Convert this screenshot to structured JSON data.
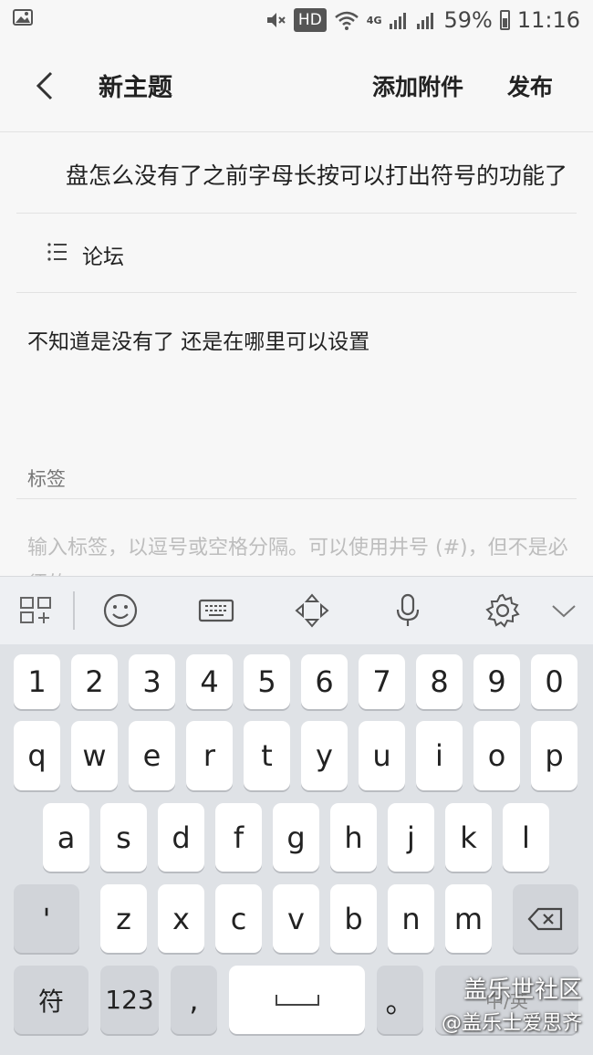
{
  "status_bar": {
    "hd": "HD",
    "network": "4G",
    "battery": "59%",
    "time": "11:16"
  },
  "header": {
    "title": "新主题",
    "attach_label": "添加附件",
    "publish_label": "发布"
  },
  "post": {
    "title": "盘怎么没有了之前字母长按可以打出符号的功能了",
    "category": "论坛",
    "body": "不知道是没有了 还是在哪里可以设置",
    "tag_label": "标签",
    "tag_placeholder": "输入标签，以逗号或空格分隔。可以使用井号 (#)，但不是必须的。"
  },
  "keyboard": {
    "number_row": [
      "1",
      "2",
      "3",
      "4",
      "5",
      "6",
      "7",
      "8",
      "9",
      "0"
    ],
    "row1": [
      "q",
      "w",
      "e",
      "r",
      "t",
      "y",
      "u",
      "i",
      "o",
      "p"
    ],
    "row2": [
      "a",
      "s",
      "d",
      "f",
      "g",
      "h",
      "j",
      "k",
      "l"
    ],
    "row3": [
      "'",
      "z",
      "x",
      "c",
      "v",
      "b",
      "n",
      "m"
    ],
    "symbol_key": "符",
    "num_key": "123",
    "comma_key": ",",
    "period_key": "。",
    "lang_key": "中/英"
  },
  "watermark": {
    "line1": "盖乐世社区",
    "line2": "@盖乐士爱思齐"
  },
  "colors": {
    "background": "#f7f7f7",
    "keyboard_bg": "#dfe2e6",
    "key": "#ffffff",
    "func_key": "#d1d4d9"
  }
}
